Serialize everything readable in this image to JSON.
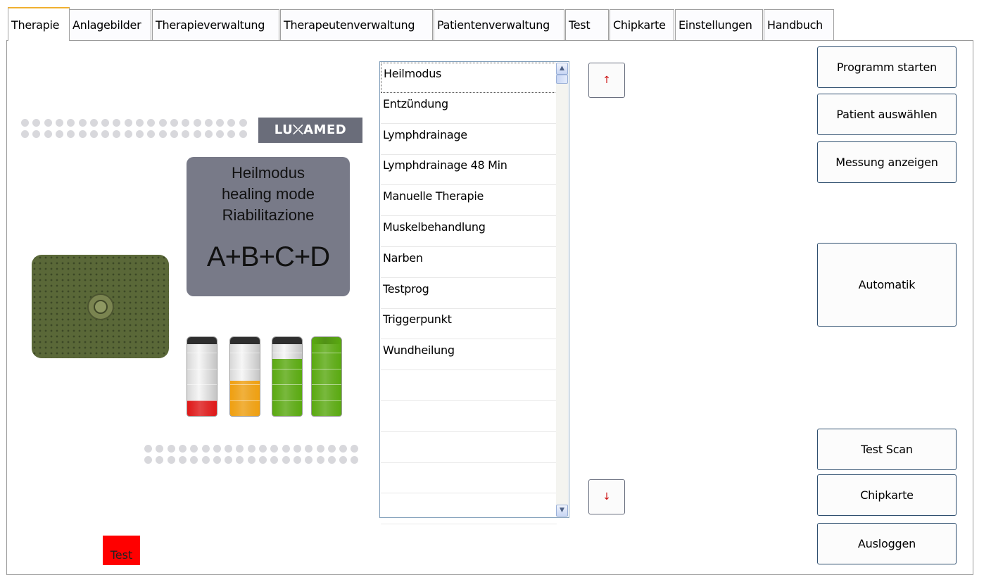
{
  "tabs": [
    {
      "label": "Therapie",
      "active": true
    },
    {
      "label": "Anlagebilder"
    },
    {
      "label": "Therapieverwaltung"
    },
    {
      "label": "Therapeutenverwaltung"
    },
    {
      "label": "Patientenverwaltung"
    },
    {
      "label": "Test"
    },
    {
      "label": "Chipkarte"
    },
    {
      "label": "Einstellungen"
    },
    {
      "label": "Handbuch"
    }
  ],
  "image": {
    "logo": "LU⤫AMED",
    "mode_lines": [
      "Heilmodus",
      "healing mode",
      "Riabilitazione"
    ],
    "mode_code": "A+B+C+D",
    "battery_levels": [
      0.2,
      0.45,
      0.72,
      1.0
    ],
    "battery_colors": [
      "#e01818",
      "#f0a010",
      "#5aaa10",
      "#5aaa10"
    ]
  },
  "program_list": {
    "items": [
      "Heilmodus",
      "Entzündung",
      "Lymphdrainage",
      "Lymphdrainage 48 Min",
      "Manuelle Therapie",
      "Muskelbehandlung",
      "Narben",
      "Testprog",
      "Triggerpunkt",
      "Wundheilung",
      "",
      "",
      "",
      "",
      ""
    ],
    "selected_index": 0
  },
  "nav": {
    "up_icon": "↑",
    "down_icon": "↓"
  },
  "buttons": {
    "programm_starten": "Programm starten",
    "patient_auswaehlen": "Patient auswählen",
    "messung_anzeigen": "Messung anzeigen",
    "automatik": "Automatik",
    "test_scan": "Test Scan",
    "chipkarte": "Chipkarte",
    "ausloggen": "Ausloggen"
  },
  "status": {
    "test_label": "Test",
    "test_color": "#ff0000"
  }
}
